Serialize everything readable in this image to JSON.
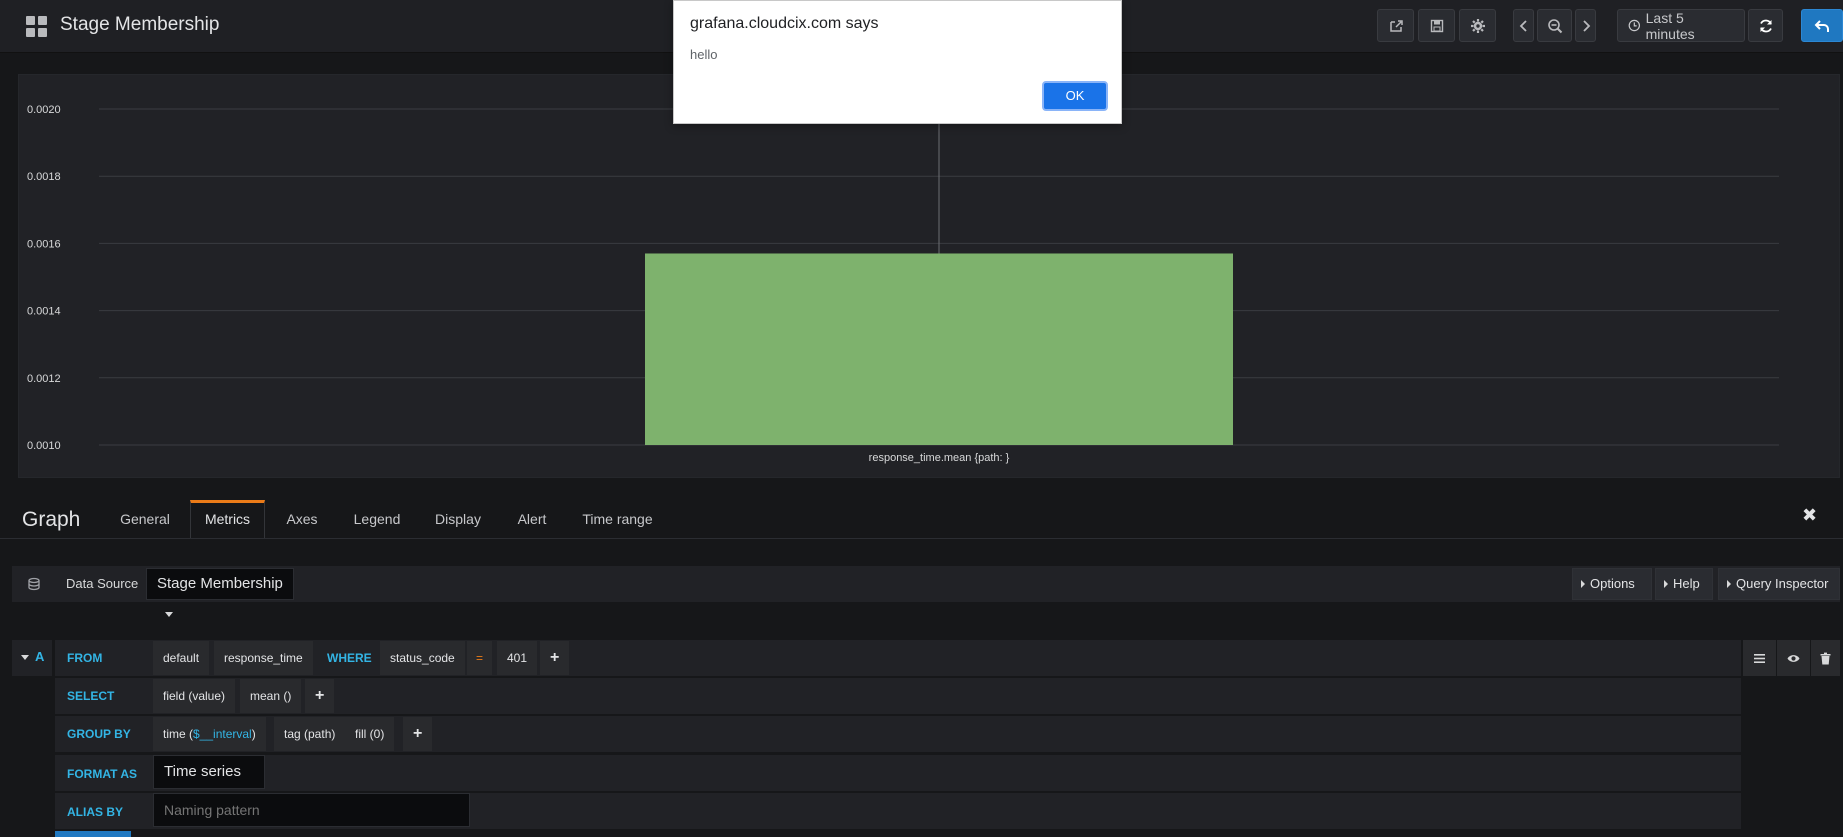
{
  "navbar": {
    "title": "Stage Membership",
    "time_range": "Last 5 minutes",
    "icons": [
      "grid-icon",
      "share-icon",
      "save-icon",
      "gear-icon",
      "chevron-left-icon",
      "zoom-out-icon",
      "chevron-right-icon",
      "clock-icon",
      "refresh-icon",
      "back-arrow-icon"
    ]
  },
  "chart_data": {
    "type": "bar",
    "categories": [
      "response_time.mean {path: }"
    ],
    "series": [
      {
        "name": "response_time.mean {path: }",
        "values": [
          0.00157
        ],
        "color": "#7eb26d"
      }
    ],
    "y_ticks": [
      "0.0020",
      "0.0018",
      "0.0016",
      "0.0014",
      "0.0012",
      "0.0010"
    ],
    "ylim": [
      0.001,
      0.002
    ],
    "grid": true,
    "crosshair": true
  },
  "editor": {
    "title": "Graph",
    "tabs": [
      "General",
      "Metrics",
      "Axes",
      "Legend",
      "Display",
      "Alert",
      "Time range"
    ],
    "active_tab": "Metrics",
    "close_label": "✖"
  },
  "datasource": {
    "label": "Data Source",
    "selected": "Stage Membership",
    "options_label": "Options",
    "help_label": "Help",
    "inspector_label": "Query Inspector"
  },
  "query": {
    "ref": "A",
    "from_kw": "FROM",
    "policy": "default",
    "measurement": "response_time",
    "where_kw": "WHERE",
    "where_key": "status_code",
    "where_op": "=",
    "where_value": "401",
    "select_kw": "SELECT",
    "select_field": "field (value)",
    "select_fn": "mean ()",
    "groupby_kw": "GROUP BY",
    "groupby_time_prefix": "time (",
    "groupby_time_var": "$__interval",
    "groupby_time_suffix": ")",
    "groupby_tag": "tag (path)",
    "groupby_fill": "fill (0)",
    "format_kw": "FORMAT AS",
    "format_value": "Time series",
    "alias_kw": "ALIAS BY",
    "alias_placeholder": "Naming pattern",
    "plus": "+"
  },
  "dialog": {
    "title": "grafana.cloudcix.com says",
    "message": "hello",
    "ok_label": "OK"
  },
  "colors": {
    "bar": "#7eb26d",
    "accent_tab": "#eb7b18",
    "keyword": "#33b5e5",
    "primary": "#1f78c1"
  }
}
